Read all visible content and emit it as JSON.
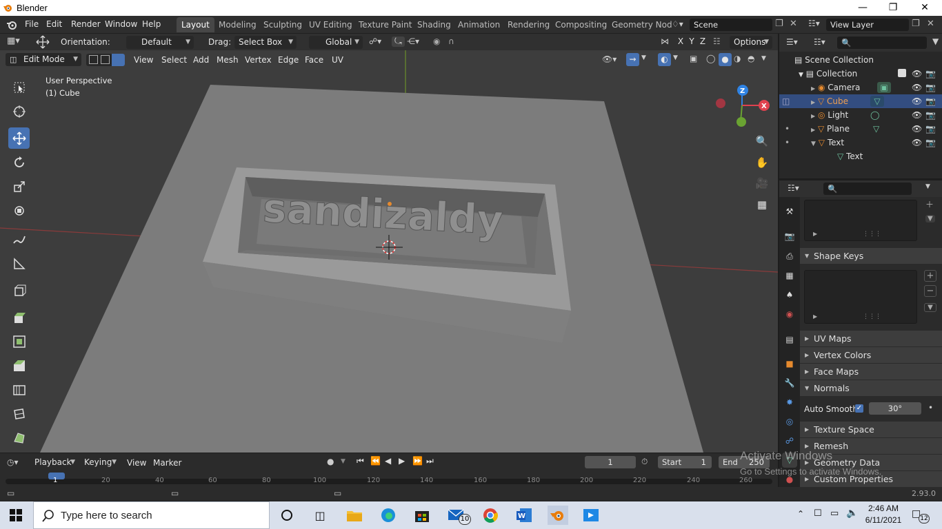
{
  "window": {
    "title": "Blender"
  },
  "menu": [
    "File",
    "Edit",
    "Render",
    "Window",
    "Help"
  ],
  "workspaces": [
    "Layout",
    "Modeling",
    "Sculpting",
    "UV Editing",
    "Texture Paint",
    "Shading",
    "Animation",
    "Rendering",
    "Compositing",
    "Geometry Nod"
  ],
  "scene": {
    "name": "Scene",
    "view_layer": "View Layer"
  },
  "tool_header": {
    "orientation_label": "Orientation:",
    "orientation_value": "Default",
    "drag_label": "Drag:",
    "drag_value": "Select Box",
    "transform_space": "Global",
    "axes": [
      "X",
      "Y",
      "Z"
    ],
    "options": "Options"
  },
  "view_header": {
    "mode": "Edit Mode",
    "menus": [
      "View",
      "Select",
      "Add",
      "Mesh",
      "Vertex",
      "Edge",
      "Face",
      "UV"
    ]
  },
  "viewport": {
    "info_line1": "User Perspective",
    "info_line2": "(1) Cube",
    "text_object": "sandizaldy"
  },
  "gizmo": {
    "z": "Z",
    "x": "X"
  },
  "outliner": {
    "root": "Scene Collection",
    "collection": "Collection",
    "items": [
      {
        "name": "Camera",
        "icon": "camera-icon",
        "selected": false
      },
      {
        "name": "Cube",
        "icon": "mesh-icon",
        "selected": true
      },
      {
        "name": "Light",
        "icon": "light-icon",
        "selected": false
      },
      {
        "name": "Plane",
        "icon": "mesh-icon",
        "selected": false
      },
      {
        "name": "Text",
        "icon": "mesh-icon",
        "selected": false
      }
    ],
    "child": "Text"
  },
  "properties": {
    "shape_keys": "Shape Keys",
    "uv_maps": "UV Maps",
    "vertex_colors": "Vertex Colors",
    "face_maps": "Face Maps",
    "normals": "Normals",
    "auto_smooth_label": "Auto Smooth",
    "auto_smooth_angle": "30°",
    "texture_space": "Texture Space",
    "remesh": "Remesh",
    "geometry_data": "Geometry Data",
    "custom_properties": "Custom Properties"
  },
  "timeline": {
    "menus": [
      "Playback",
      "Keying",
      "View",
      "Marker"
    ],
    "current_frame": "1",
    "start_label": "Start",
    "start_value": "1",
    "end_label": "End",
    "end_value": "250",
    "ticks": [
      "1",
      "20",
      "40",
      "60",
      "80",
      "100",
      "120",
      "140",
      "160",
      "180",
      "200",
      "220",
      "240",
      "260"
    ]
  },
  "watermark": {
    "line1": "Activate Windows",
    "line2": "Go to Settings to activate Windows."
  },
  "statusbar": {
    "version": "2.93.0"
  },
  "taskbar": {
    "search_placeholder": "Type here to search",
    "time": "2:46 AM",
    "date": "6/11/2021",
    "mail_badge": "10",
    "notif_badge": "12"
  },
  "colors": {
    "accent": "#4772b3",
    "selected_row": "#334d80",
    "x_axis": "#e0424f",
    "y_axis": "#6aa332",
    "z_axis": "#2f83e4",
    "object_orange": "#e68a2e"
  }
}
